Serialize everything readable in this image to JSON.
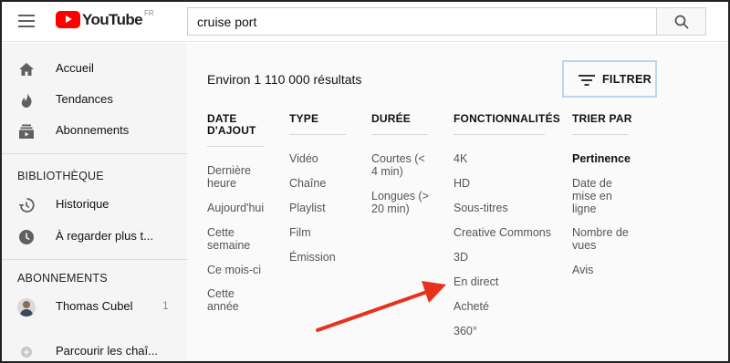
{
  "header": {
    "logo_text": "YouTube",
    "logo_country": "FR",
    "search_value": "cruise port"
  },
  "sidebar": {
    "items": [
      {
        "label": "Accueil",
        "icon": "home-icon"
      },
      {
        "label": "Tendances",
        "icon": "flame-icon"
      },
      {
        "label": "Abonnements",
        "icon": "subscriptions-icon"
      }
    ],
    "library_title": "BIBLIOTHÈQUE",
    "library_items": [
      {
        "label": "Historique",
        "icon": "history-icon"
      },
      {
        "label": "À regarder plus t...",
        "icon": "clock-icon"
      }
    ],
    "subscriptions_title": "ABONNEMENTS",
    "channel": {
      "name": "Thomas Cubel",
      "count": "1"
    },
    "browse_label": "Parcourir les chaî..."
  },
  "main": {
    "results_count": "Environ 1 110 000 résultats",
    "filter_label": "FILTRER",
    "columns": [
      {
        "header": "DATE D'AJOUT",
        "header_lines": [
          "DATE",
          "D'AJOUT"
        ],
        "options": [
          [
            "Dernière",
            "heure"
          ],
          [
            "Aujourd'hui"
          ],
          [
            "Cette",
            "semaine"
          ],
          [
            "Ce mois-ci"
          ],
          [
            "Cette",
            "année"
          ]
        ]
      },
      {
        "header": "TYPE",
        "header_lines": [
          "TYPE"
        ],
        "options": [
          [
            "Vidéo"
          ],
          [
            "Chaîne"
          ],
          [
            "Playlist"
          ],
          [
            "Film"
          ],
          [
            "Émission"
          ]
        ]
      },
      {
        "header": "DURÉE",
        "header_lines": [
          "DURÉE"
        ],
        "options": [
          [
            "Courtes (<",
            "4 min)"
          ],
          [
            "Longues (>",
            "20 min)"
          ]
        ]
      },
      {
        "header": "FONCTIONNALITÉS",
        "header_lines": [
          "FONCTIONNALITÉS"
        ],
        "options": [
          [
            "4K"
          ],
          [
            "HD"
          ],
          [
            "Sous-titres"
          ],
          [
            "Creative Commons"
          ],
          [
            "3D"
          ],
          [
            "En direct"
          ],
          [
            "Acheté"
          ],
          [
            "360°"
          ]
        ]
      },
      {
        "header": "TRIER PAR",
        "header_lines": [
          "TRIER PAR"
        ],
        "options": [
          [
            "Pertinence"
          ],
          [
            "Date de",
            "mise en",
            "ligne"
          ],
          [
            "Nombre de",
            "vues"
          ],
          [
            "Avis"
          ]
        ],
        "selected_index": 0
      }
    ]
  },
  "annotation": {
    "arrow_color": "#e8311a"
  }
}
